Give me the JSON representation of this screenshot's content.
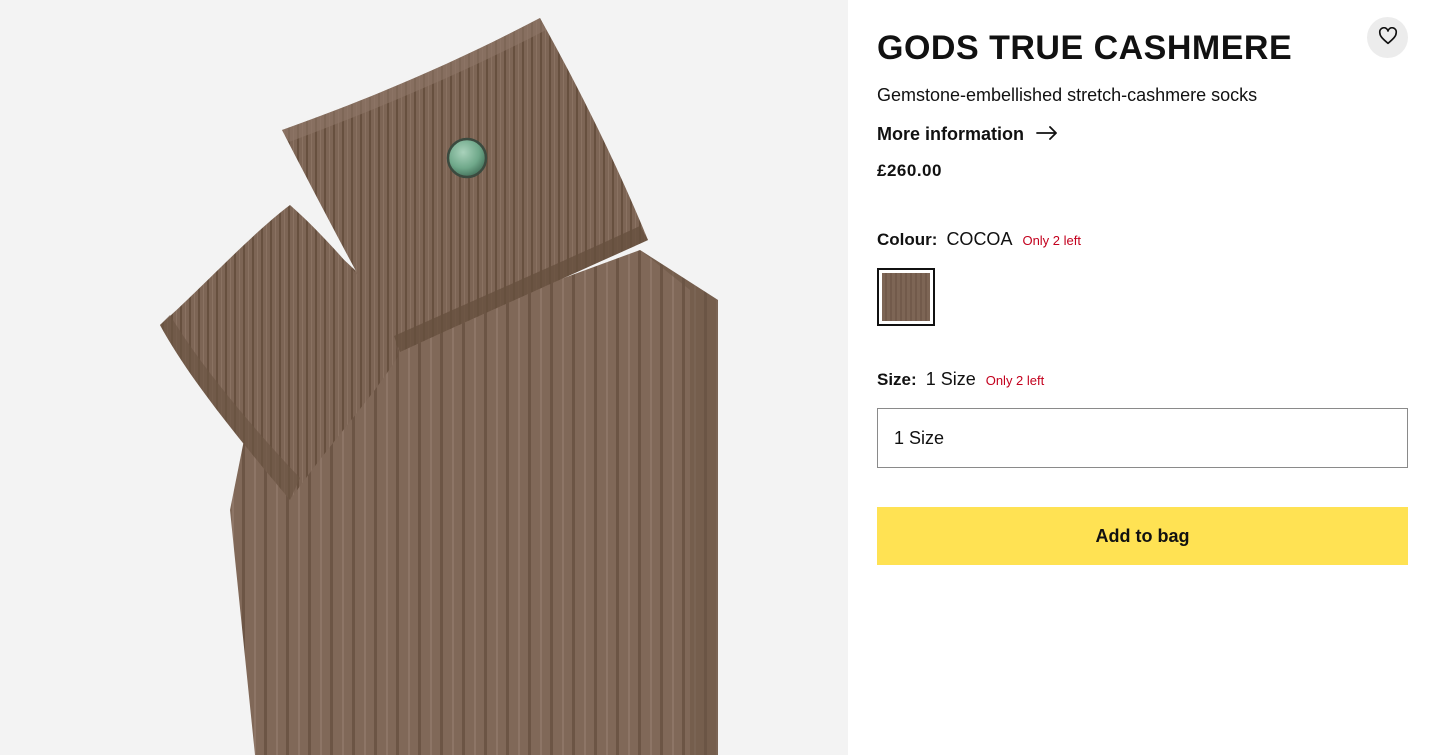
{
  "product": {
    "brand": "GODS TRUE CASHMERE",
    "name": "Gemstone-embellished stretch-cashmere socks",
    "more_info_label": "More information",
    "price": "£260.00"
  },
  "colour": {
    "label": "Colour:",
    "value": "COCOA",
    "stock": "Only 2 left",
    "swatch_color": "#7a6252"
  },
  "size": {
    "label": "Size:",
    "value": "1 Size",
    "stock": "Only 2 left",
    "selected": "1 Size"
  },
  "actions": {
    "add_to_bag": "Add to bag"
  },
  "icons": {
    "wishlist": "heart-icon",
    "more_info": "arrow-right-icon"
  },
  "colors": {
    "accent_button": "#ffe253",
    "stock_warning": "#c3001d",
    "product_brown": "#7d6555",
    "gem_green": "#6fa88a"
  }
}
